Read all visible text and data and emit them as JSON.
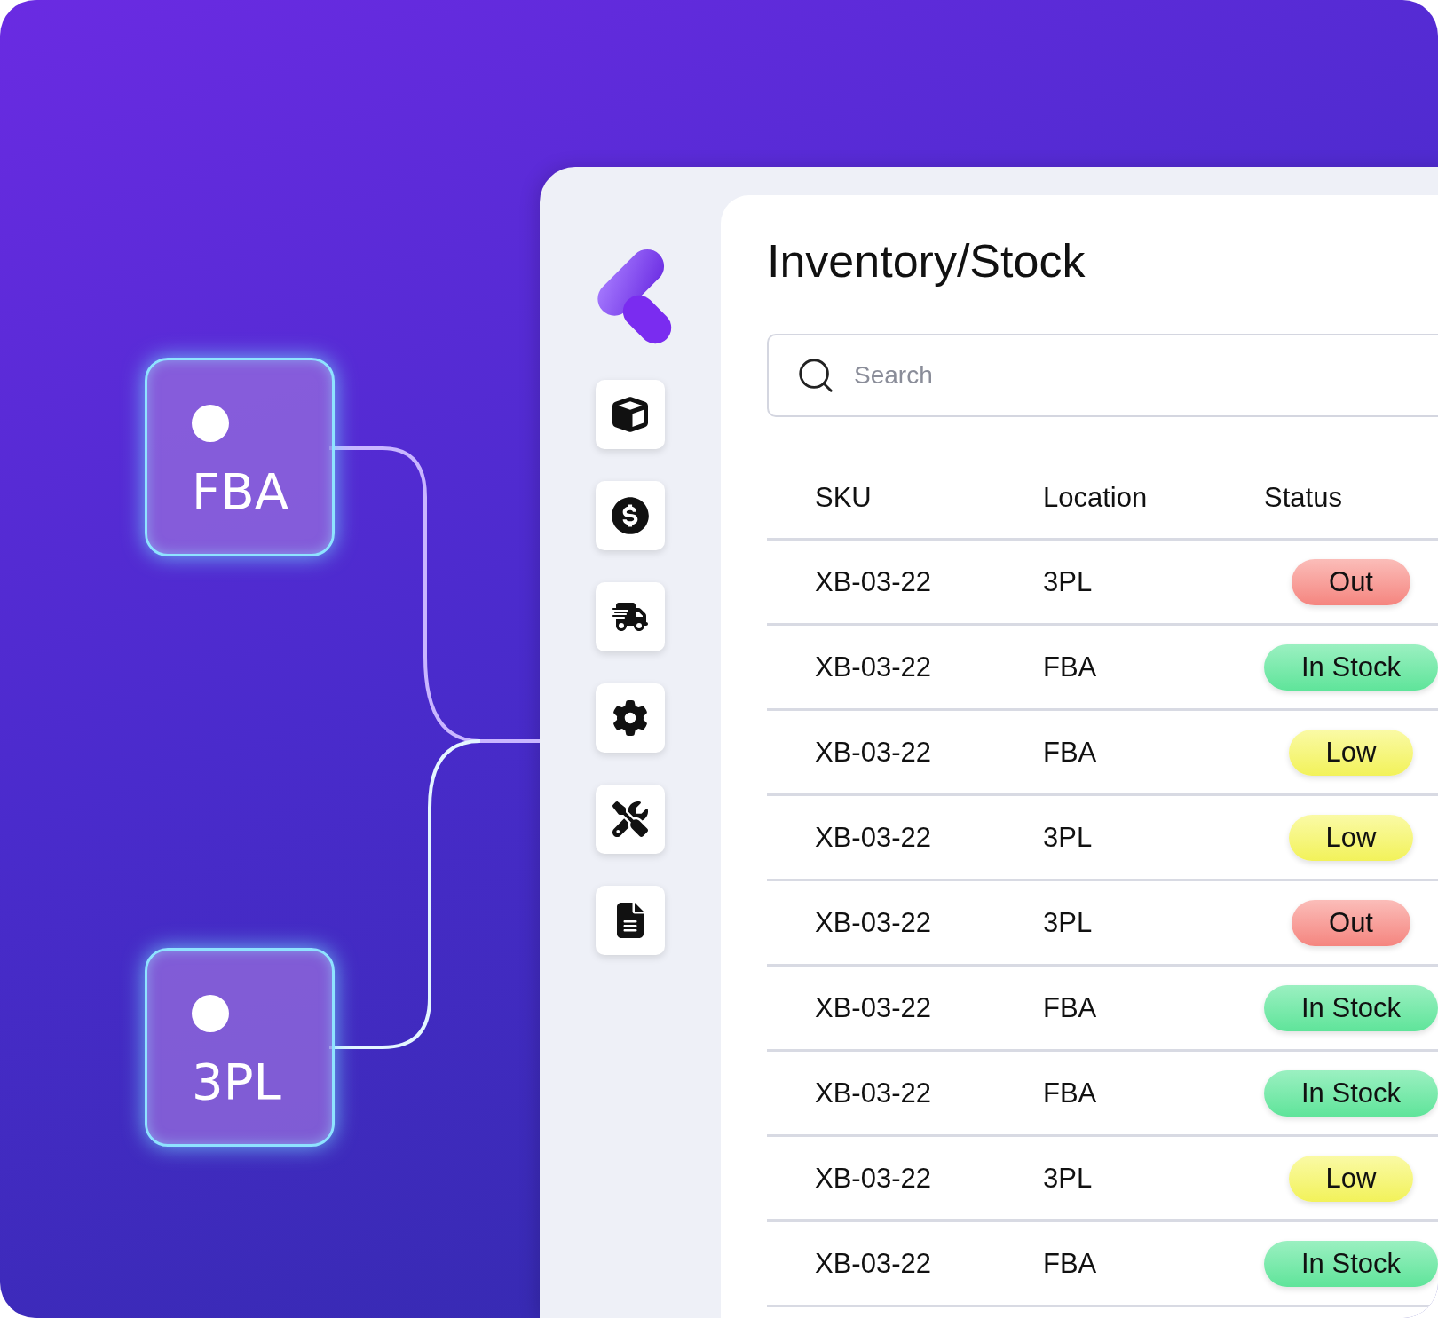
{
  "nodes": [
    {
      "label": "FBA"
    },
    {
      "label": "3PL"
    }
  ],
  "app": {
    "title": "Inventory/Stock",
    "search": {
      "placeholder": "Search"
    },
    "columns": [
      "SKU",
      "Location",
      "Status"
    ],
    "rows": [
      {
        "sku": "XB-03-22",
        "location": "3PL",
        "status": {
          "label": "Out",
          "kind": "out"
        }
      },
      {
        "sku": "XB-03-22",
        "location": "FBA",
        "status": {
          "label": "In Stock",
          "kind": "instock"
        }
      },
      {
        "sku": "XB-03-22",
        "location": "FBA",
        "status": {
          "label": "Low",
          "kind": "low"
        }
      },
      {
        "sku": "XB-03-22",
        "location": "3PL",
        "status": {
          "label": "Low",
          "kind": "low"
        }
      },
      {
        "sku": "XB-03-22",
        "location": "3PL",
        "status": {
          "label": "Out",
          "kind": "out"
        }
      },
      {
        "sku": "XB-03-22",
        "location": "FBA",
        "status": {
          "label": "In Stock",
          "kind": "instock"
        }
      },
      {
        "sku": "XB-03-22",
        "location": "FBA",
        "status": {
          "label": "In Stock",
          "kind": "instock"
        }
      },
      {
        "sku": "XB-03-22",
        "location": "3PL",
        "status": {
          "label": "Low",
          "kind": "low"
        }
      },
      {
        "sku": "XB-03-22",
        "location": "FBA",
        "status": {
          "label": "In Stock",
          "kind": "instock"
        }
      }
    ]
  }
}
